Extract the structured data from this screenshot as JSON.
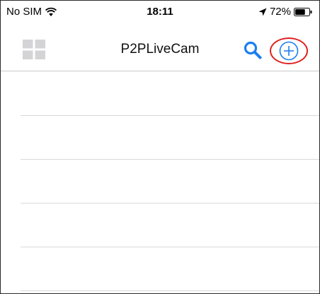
{
  "status_bar": {
    "carrier": "No SIM",
    "time": "18:11",
    "battery_percent": "72%",
    "battery_level": 0.72,
    "icons": [
      "wifi-icon",
      "location-arrow-icon",
      "battery-icon"
    ]
  },
  "nav_bar": {
    "title": "P2PLiveCam",
    "left_icon": "grid-icon",
    "right_icons": [
      "search-icon",
      "add-circle-icon"
    ],
    "highlight_color": "#e02020",
    "accent_color": "#1a7ef0"
  },
  "device_list": {
    "rows": [
      {
        "text": ""
      },
      {
        "text": ""
      },
      {
        "text": ""
      },
      {
        "text": ""
      },
      {
        "text": ""
      }
    ]
  }
}
